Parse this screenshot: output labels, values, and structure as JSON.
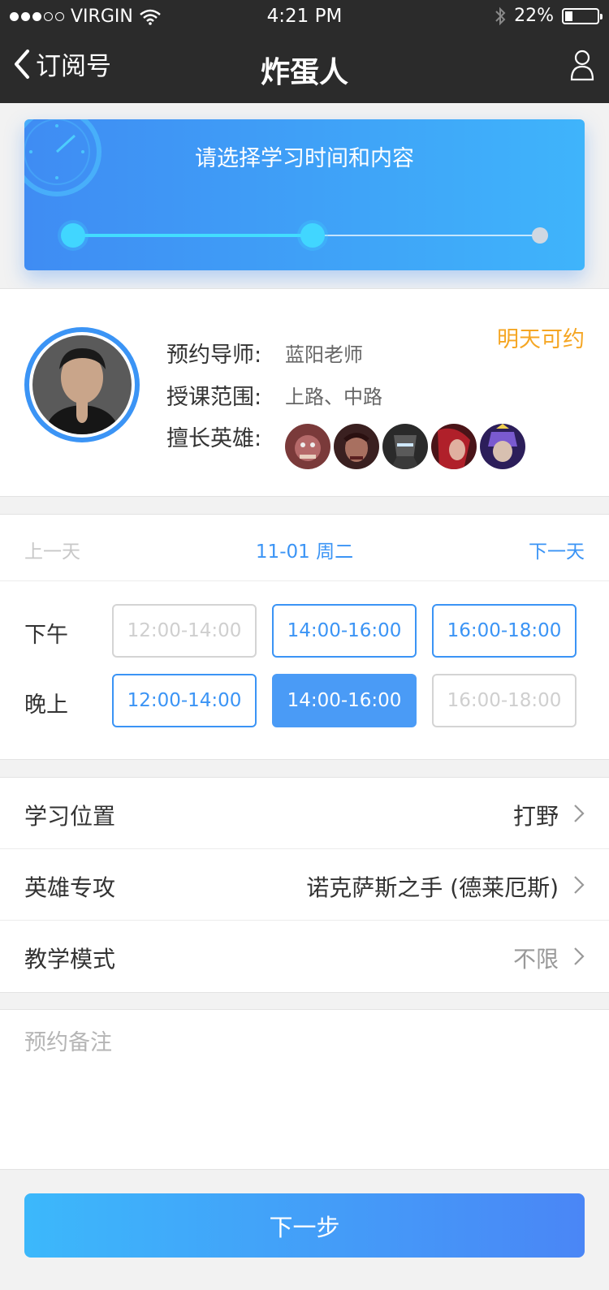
{
  "status": {
    "carrier": "VIRGIN",
    "time": "4:21 PM",
    "battery": "22%",
    "battery_level": 0.22
  },
  "nav": {
    "back_label": "订阅号",
    "title": "炸蛋人"
  },
  "progress": {
    "title": "请选择学习时间和内容",
    "current_step": 2,
    "total_steps": 3
  },
  "tutor": {
    "mentor_key": "预约导师:",
    "mentor_value": "蓝阳老师",
    "scope_key": "授课范围:",
    "scope_value": "上路、中路",
    "heroes_key": "擅长英雄:",
    "availability": "明天可约",
    "hero_icons": [
      "hero-1-icon",
      "hero-2-icon",
      "hero-3-icon",
      "hero-4-icon",
      "hero-5-icon"
    ]
  },
  "date": {
    "prev": "上一天",
    "current": "11-01 周二",
    "next": "下一天"
  },
  "slots": {
    "afternoon": {
      "label": "下午",
      "items": [
        {
          "time": "12:00-14:00",
          "state": "disabled"
        },
        {
          "time": "14:00-16:00",
          "state": "available"
        },
        {
          "time": "16:00-18:00",
          "state": "available"
        }
      ]
    },
    "evening": {
      "label": "晚上",
      "items": [
        {
          "time": "12:00-14:00",
          "state": "available"
        },
        {
          "time": "14:00-16:00",
          "state": "selected"
        },
        {
          "time": "16:00-18:00",
          "state": "disabled"
        }
      ]
    }
  },
  "options": {
    "position": {
      "label": "学习位置",
      "value": "打野"
    },
    "hero": {
      "label": "英雄专攻",
      "value": "诺克萨斯之手 (德莱厄斯)"
    },
    "mode": {
      "label": "教学模式",
      "value": "不限"
    }
  },
  "notes": {
    "placeholder": "预约备注"
  },
  "submit": {
    "label": "下一步"
  },
  "colors": {
    "accent": "#3b94f5",
    "nav_bg": "#2b2b2b",
    "availability": "#f5a623"
  }
}
